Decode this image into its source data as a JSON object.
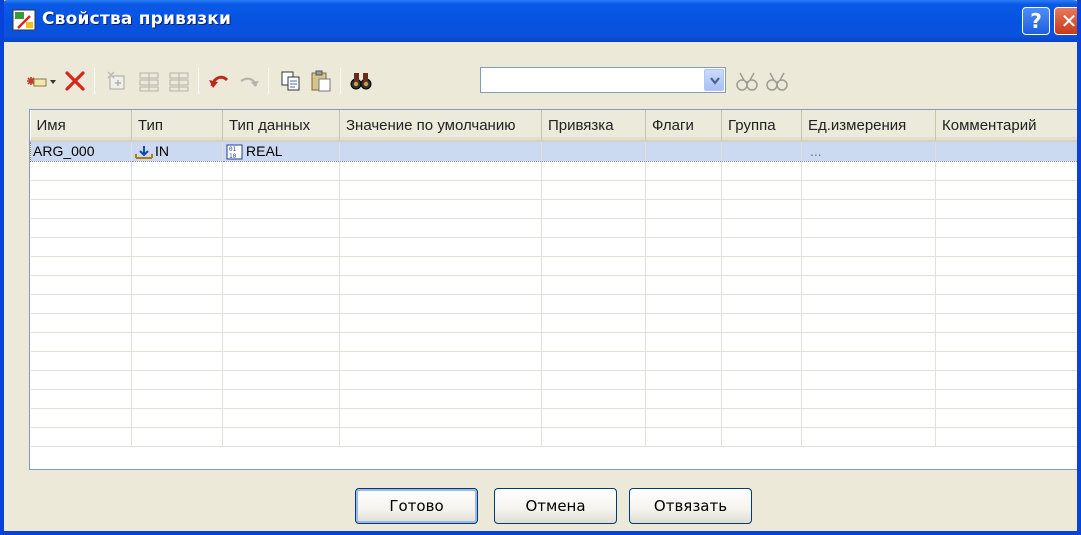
{
  "window": {
    "title": "Свойства привязки"
  },
  "titlebar": {
    "help_label": "?",
    "close_label": "✕"
  },
  "toolbar": {
    "icons": [
      "add-dropdown-icon",
      "delete-icon",
      "insert-icon",
      "move-up-icon",
      "move-down-icon",
      "undo-icon",
      "redo-icon",
      "copy-icon",
      "paste-icon",
      "find-icon",
      "find-previous-icon",
      "find-next-icon"
    ],
    "search": {
      "value": "",
      "placeholder": ""
    }
  },
  "table": {
    "columns": [
      "Имя",
      "Тип",
      "Тип данных",
      "Значение по умолчанию",
      "Привязка",
      "Флаги",
      "Группа",
      "Ед.измерения",
      "Комментарий"
    ],
    "rows": [
      {
        "name": "ARG_000",
        "type": "IN",
        "datatype": "REAL",
        "default": "",
        "binding": "",
        "flags": "",
        "group": "",
        "unit": "...",
        "comment": ""
      }
    ],
    "empty_rows": 15
  },
  "buttons": {
    "ok": "Готово",
    "cancel": "Отмена",
    "unbind": "Отвязать"
  },
  "colors": {
    "title_bar": "#0653e2",
    "selection": "#cbd9f1",
    "face": "#ece9d8"
  }
}
